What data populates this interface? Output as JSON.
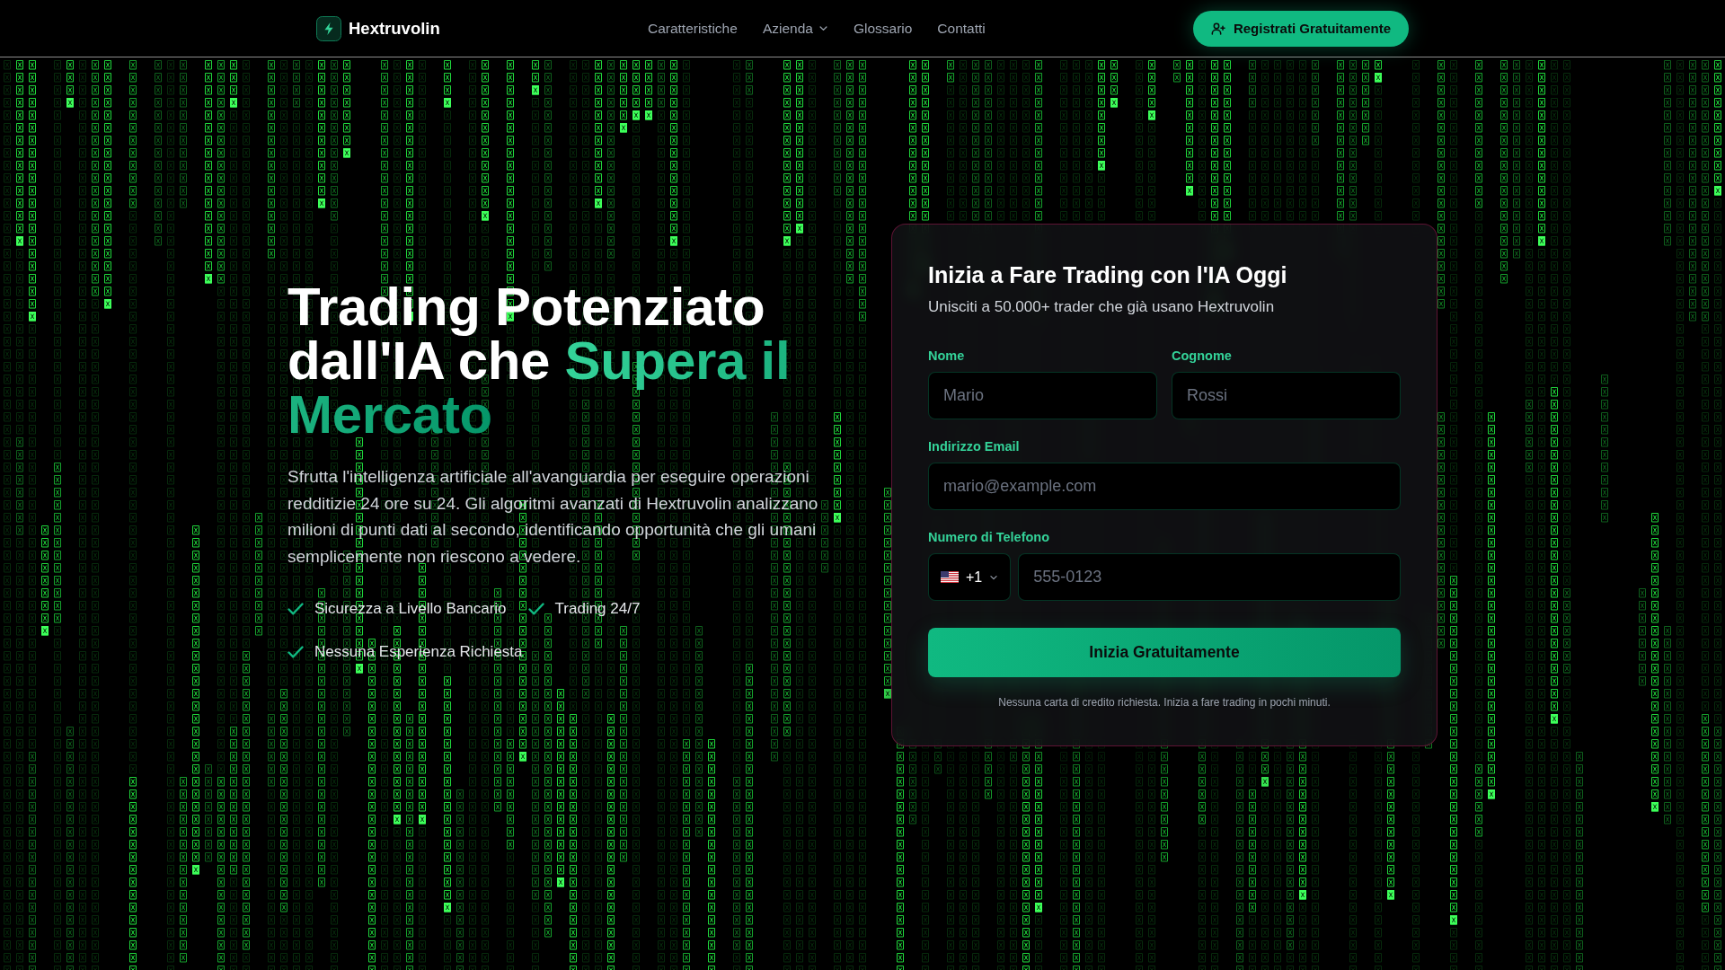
{
  "nav": {
    "brand": "Hextruvolin",
    "links": [
      {
        "label": "Caratteristiche",
        "kind": "link"
      },
      {
        "label": "Azienda",
        "kind": "dropdown"
      },
      {
        "label": "Glossario",
        "kind": "link"
      },
      {
        "label": "Contatti",
        "kind": "link"
      }
    ],
    "cta": "Registrati Gratuitamente"
  },
  "hero": {
    "headline": "Trading Potenziato dall'IA che",
    "headline_highlight": "Supera il Mercato",
    "description": "Sfrutta l'intelligenza artificiale all'avanguardia per eseguire operazioni redditizie 24 ore su 24. Gli algoritmi avanzati di Hextruvolin analizzano milioni di punti dati al secondo, identificando opportunità che gli umani semplicemente non riescono a vedere.",
    "features": [
      "Sicurezza a Livello Bancario",
      "Trading 24/7",
      "Nessuna Esperienza Richiesta"
    ]
  },
  "signup_form": {
    "title": "Inizia a Fare Trading con l'IA Oggi",
    "subtitle": "Unisciti a 50.000+ trader che già usano Hextruvolin",
    "rows": [
      [
        {
          "kind": "text",
          "label": "Nome",
          "placeholder": "Mario"
        },
        {
          "kind": "text",
          "label": "Cognome",
          "placeholder": "Rossi"
        }
      ],
      [
        {
          "kind": "email",
          "label": "Indirizzo Email",
          "placeholder": "mario@example.com"
        }
      ],
      [
        {
          "kind": "phone",
          "label": "Numero di Telefono",
          "country_code": "+1",
          "placeholder": "555-0123"
        }
      ]
    ],
    "submit": "Inizia Gratuitamente",
    "note": "Nessuna carta di credito richiesta. Inizia a fare trading in pochi minuti."
  }
}
